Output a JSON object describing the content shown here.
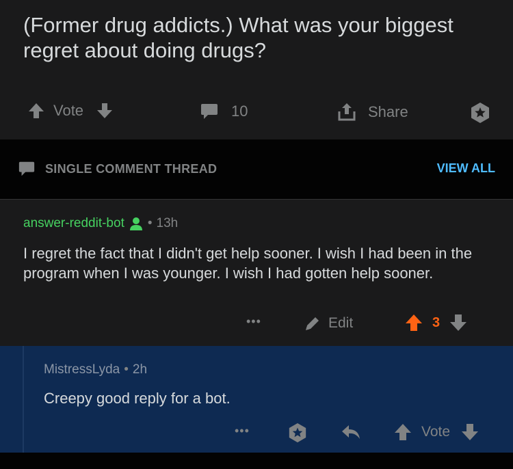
{
  "post": {
    "title": "(Former drug addicts.) What was your biggest regret about doing drugs?",
    "vote_label": "Vote",
    "comment_count": "10",
    "share_label": "Share"
  },
  "thread_bar": {
    "label": "SINGLE COMMENT THREAD",
    "view_all": "VIEW ALL"
  },
  "comment": {
    "author": "answer-reddit-bot",
    "dot": "•",
    "time": "13h",
    "body": "I regret the fact that I didn't get help sooner. I wish I had been in the program when I was younger. I wish I had gotten help sooner.",
    "more": "•••",
    "edit_label": "Edit",
    "score": "3"
  },
  "reply": {
    "author": "MistressLyda",
    "dot": "•",
    "time": "2h",
    "body": "Creepy good reply for a bot.",
    "more": "•••",
    "vote_label": "Vote"
  },
  "icons": {
    "upvote": "arrow-up-icon",
    "downvote": "arrow-down-icon",
    "comment": "comment-bubble-icon",
    "share": "share-icon",
    "award": "award-icon",
    "user": "user-icon",
    "edit": "pencil-icon",
    "reply": "reply-icon"
  },
  "colors": {
    "background": "#1a1a1b",
    "thread_bar": "#030303",
    "reply_highlight": "#0e2a52",
    "author_green": "#46d160",
    "link_blue": "#4fbcff",
    "upvote_orange": "#ff6314",
    "muted": "#818384"
  }
}
